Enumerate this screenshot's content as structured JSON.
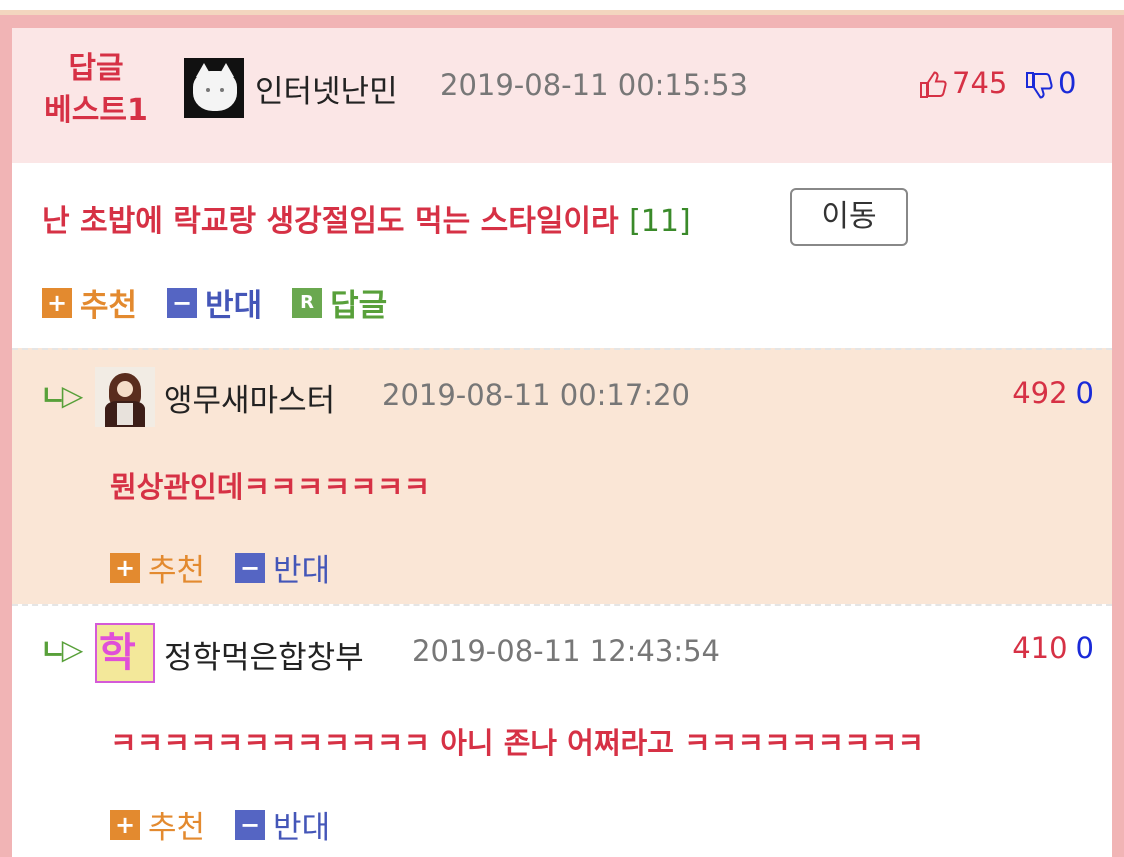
{
  "best": {
    "badge_line1": "답글",
    "badge_line2": "베스트1",
    "username": "인터넷난민",
    "timestamp": "2019-08-11 00:15:53",
    "upvotes": "745",
    "downvotes": "0",
    "title": "난 초밥에 락교랑 생강절임도 먹는 스타일이라",
    "reply_count": "[11]",
    "move_label": "이동",
    "recommend_label": "추천",
    "oppose_label": "반대",
    "reply_label": "답글"
  },
  "replies": [
    {
      "arrow": "ㄴ▷",
      "username": "앵무새마스터",
      "timestamp": "2019-08-11 00:17:20",
      "upvotes": "492",
      "downvotes": "0",
      "text": "뭔상관인데ㅋㅋㅋㅋㅋㅋㅋ",
      "recommend_label": "추천",
      "oppose_label": "반대"
    },
    {
      "arrow": "ㄴ▷",
      "username": "정학먹은합창부",
      "timestamp": "2019-08-11 12:43:54",
      "upvotes": "410",
      "downvotes": "0",
      "text": "ㅋㅋㅋㅋㅋㅋㅋㅋㅋㅋㅋㅋ 아니 존나 어쩌라고 ㅋㅋㅋㅋㅋㅋㅋㅋㅋ",
      "recommend_label": "추천",
      "oppose_label": "반대",
      "avatar_text": "학"
    }
  ],
  "icons": {
    "plus": "+",
    "minus": "−",
    "reply": "R"
  },
  "colors": {
    "accent_red": "#d63145",
    "vote_blue": "#1a2ad8",
    "recommend_orange": "#e38a2f",
    "oppose_blue": "#5565c3",
    "reply_green": "#6aa84f"
  }
}
